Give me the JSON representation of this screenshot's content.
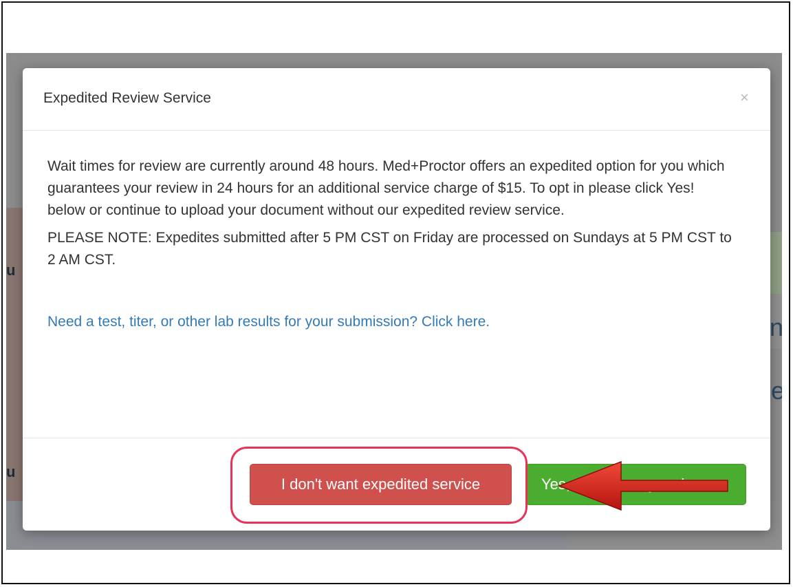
{
  "modal": {
    "title": "Expedited Review Service",
    "close_label": "×",
    "body_paragraph": "Wait times for review are currently around 48 hours. Med+Proctor offers an expedited option for you which guarantees your review in 24 hours for an additional service charge of $15. To opt in please click Yes! below or continue to upload your document without our expedited review service.",
    "note": "PLEASE NOTE: Expedites submitted after 5 PM CST on Friday are processed on Sundays at 5 PM CST to 2 AM CST.",
    "lab_link": "Need a test, titer, or other lab results for your submission? Click here.",
    "decline_button": "I don't want expedited service",
    "accept_button": "Yes, expedite my review"
  },
  "background": {
    "fragment_left_1": "u",
    "fragment_left_2": "u",
    "fragment_right_1": "n",
    "fragment_right_2": "er"
  },
  "annotations": {
    "highlight_color": "#e8325a",
    "arrow_color": "#d9201f"
  },
  "colors": {
    "decline": "#d0504d",
    "accept": "#4aad2f",
    "link": "#337ab7"
  }
}
